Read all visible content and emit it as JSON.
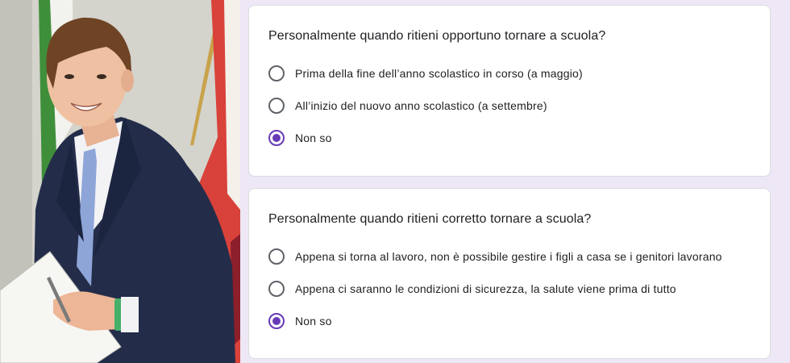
{
  "colors": {
    "accent": "#673ab7",
    "page_background": "#ede7f6",
    "card_background": "#ffffff",
    "radio_unchecked": "#5f6368"
  },
  "photo": {
    "subject": "portrait-photo"
  },
  "questions": [
    {
      "title": "Personalmente quando ritieni opportuno tornare a scuola?",
      "options": [
        {
          "label": "Prima della fine dell’anno scolastico in corso (a maggio)",
          "checked": false
        },
        {
          "label": "All’inizio del nuovo anno scolastico (a settembre)",
          "checked": false
        },
        {
          "label": "Non so",
          "checked": true
        }
      ]
    },
    {
      "title": "Personalmente quando ritieni corretto tornare a scuola?",
      "options": [
        {
          "label": "Appena si torna al lavoro, non è possibile gestire i figli a casa se i genitori lavorano",
          "checked": false
        },
        {
          "label": "Appena ci saranno le condizioni di sicurezza, la salute viene prima di tutto",
          "checked": false
        },
        {
          "label": "Non so",
          "checked": true
        }
      ]
    }
  ]
}
